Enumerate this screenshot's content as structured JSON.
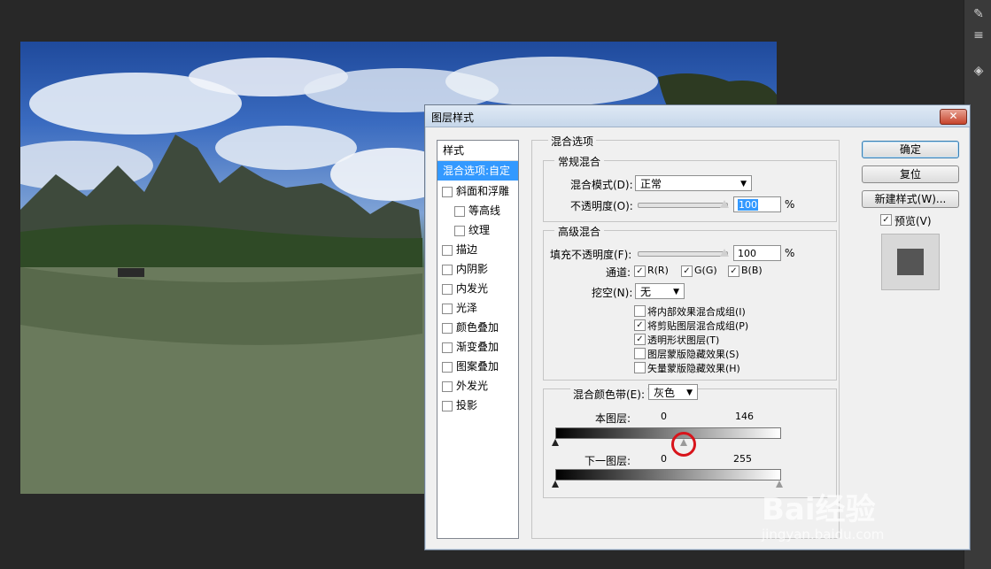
{
  "dialog": {
    "title": "图层样式",
    "close_label": "✕"
  },
  "style_list": {
    "header": "样式",
    "selected": "混合选项:自定",
    "items": [
      {
        "label": "斜面和浮雕",
        "checked": false,
        "indent": false
      },
      {
        "label": "等高线",
        "checked": false,
        "indent": true
      },
      {
        "label": "纹理",
        "checked": false,
        "indent": true
      },
      {
        "label": "描边",
        "checked": false,
        "indent": false
      },
      {
        "label": "内阴影",
        "checked": false,
        "indent": false
      },
      {
        "label": "内发光",
        "checked": false,
        "indent": false
      },
      {
        "label": "光泽",
        "checked": false,
        "indent": false
      },
      {
        "label": "颜色叠加",
        "checked": false,
        "indent": false
      },
      {
        "label": "渐变叠加",
        "checked": false,
        "indent": false
      },
      {
        "label": "图案叠加",
        "checked": false,
        "indent": false
      },
      {
        "label": "外发光",
        "checked": false,
        "indent": false
      },
      {
        "label": "投影",
        "checked": false,
        "indent": false
      }
    ]
  },
  "blend_options": {
    "section_title": "混合选项",
    "general": {
      "title": "常规混合",
      "blend_mode_label": "混合模式(D):",
      "blend_mode_value": "正常",
      "opacity_label": "不透明度(O):",
      "opacity_value": "100",
      "percent": "%"
    },
    "advanced": {
      "title": "高级混合",
      "fill_opacity_label": "填充不透明度(F):",
      "fill_opacity_value": "100",
      "percent": "%",
      "channels_label": "通道:",
      "channel_r": "R(R)",
      "channel_g": "G(G)",
      "channel_b": "B(B)",
      "knockout_label": "挖空(N):",
      "knockout_value": "无",
      "options": [
        {
          "label": "将内部效果混合成组(I)",
          "checked": false
        },
        {
          "label": "将剪贴图层混合成组(P)",
          "checked": true
        },
        {
          "label": "透明形状图层(T)",
          "checked": true
        },
        {
          "label": "图层蒙版隐藏效果(S)",
          "checked": false
        },
        {
          "label": "矢量蒙版隐藏效果(H)",
          "checked": false
        }
      ]
    },
    "blend_if": {
      "label": "混合颜色带(E):",
      "value": "灰色",
      "this_layer_label": "本图层:",
      "this_layer_low": "0",
      "this_layer_high": "146",
      "this_layer_high_fraction": 0.573,
      "underlying_label": "下一图层:",
      "underlying_low": "0",
      "underlying_high": "255"
    }
  },
  "buttons": {
    "ok": "确定",
    "reset": "复位",
    "new_style": "新建样式(W)...",
    "preview_label": "预览(V)",
    "preview_checked": true
  },
  "watermark": {
    "brand": "Bai经验",
    "url": "jingyan.baidu.com"
  },
  "colors": {
    "selection": "#3399ff",
    "highlight_circle": "#d8141b"
  }
}
